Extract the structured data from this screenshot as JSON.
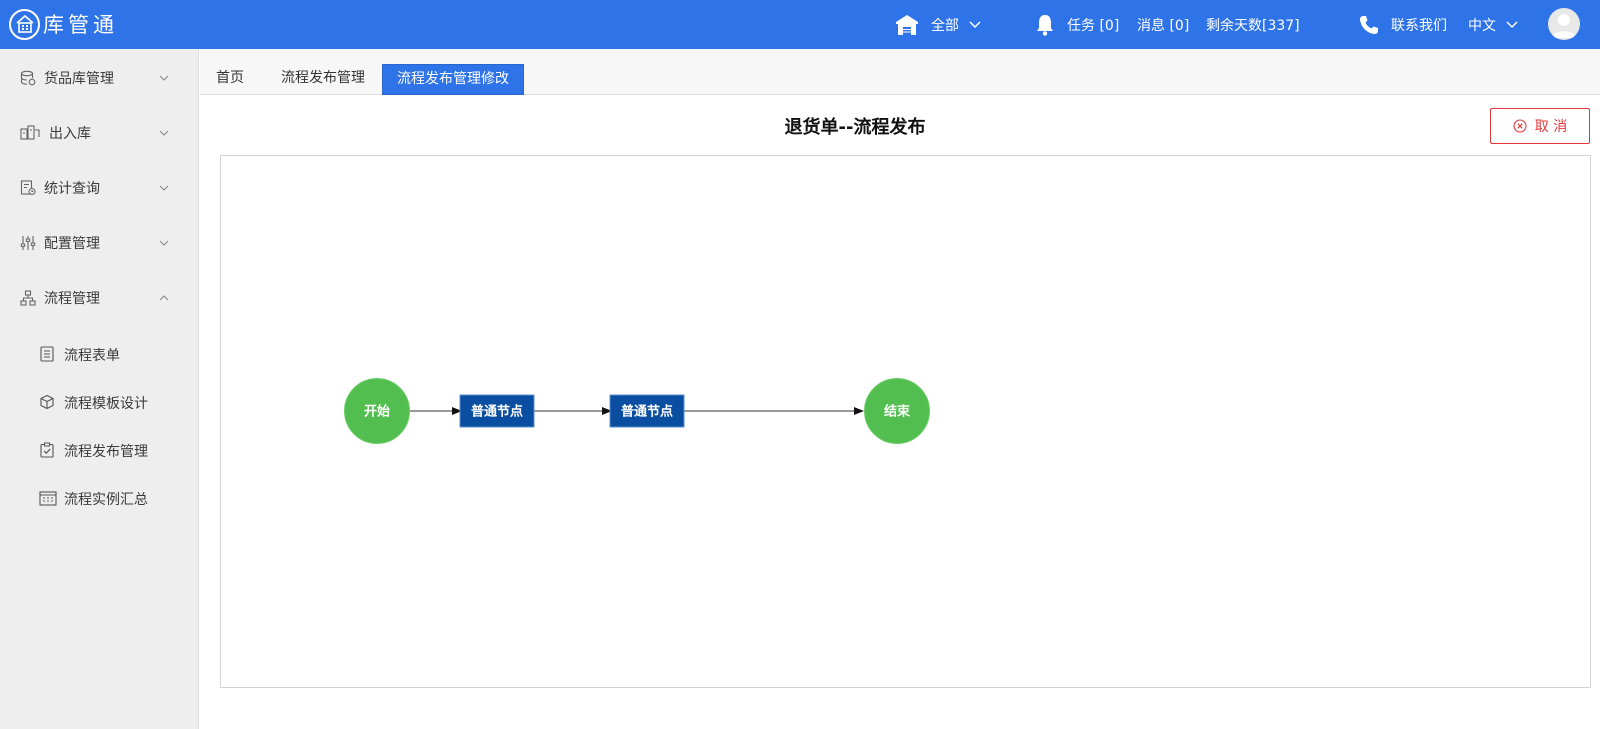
{
  "header": {
    "app_name": "库管通",
    "warehouse": "全部",
    "tasks": "任务 [0]",
    "messages": "消息 [0]",
    "days_left": "剩余天数[337]",
    "contact": "联系我们",
    "language": "中文"
  },
  "sidebar": {
    "items": [
      {
        "label": "货品库管理",
        "icon": "database-icon"
      },
      {
        "label": "出入库",
        "icon": "inout-icon"
      },
      {
        "label": "统计查询",
        "icon": "report-icon"
      },
      {
        "label": "配置管理",
        "icon": "sliders-icon"
      },
      {
        "label": "流程管理",
        "icon": "workflow-icon"
      }
    ],
    "subitems": [
      {
        "label": "流程表单",
        "icon": "form-icon"
      },
      {
        "label": "流程模板设计",
        "icon": "cube-icon"
      },
      {
        "label": "流程发布管理",
        "icon": "clipboard-check-icon"
      },
      {
        "label": "流程实例汇总",
        "icon": "calendar-grid-icon"
      }
    ]
  },
  "tabs": [
    {
      "label": "首页"
    },
    {
      "label": "流程发布管理"
    },
    {
      "label": "流程发布管理修改"
    }
  ],
  "page": {
    "title": "退货单--流程发布",
    "cancel_label": "取 消"
  },
  "flow": {
    "nodes": [
      "开始",
      "普通节点",
      "普通节点",
      "结束"
    ]
  },
  "colors": {
    "header_bg": "#2f73e8",
    "start_end_node": "#52be4f",
    "normal_node": "#0a4ea1",
    "cancel": "#e4393c"
  }
}
